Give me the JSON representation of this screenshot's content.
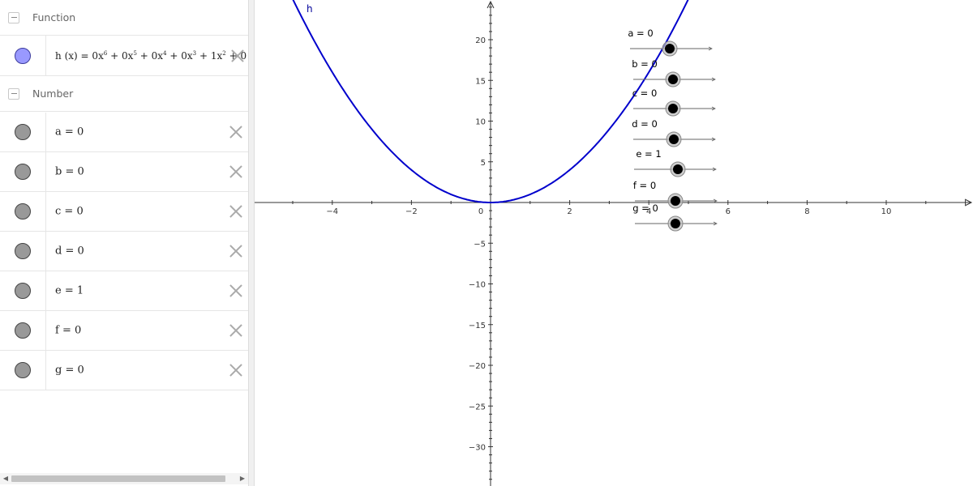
{
  "algebra": {
    "function_group": {
      "label": "Function"
    },
    "function": {
      "name": "h",
      "arg": "(x)",
      "equals": "=",
      "terms": [
        {
          "coef": "0",
          "var": "x",
          "exp": "6"
        },
        {
          "coef": "0",
          "var": "x",
          "exp": "5"
        },
        {
          "coef": "0",
          "var": "x",
          "exp": "4"
        },
        {
          "coef": "0",
          "var": "x",
          "exp": "3"
        },
        {
          "coef": "1",
          "var": "x",
          "exp": "2"
        }
      ],
      "plus": "+",
      "trailing": "0"
    },
    "number_group": {
      "label": "Number"
    },
    "numbers": [
      {
        "name": "a",
        "value": "0"
      },
      {
        "name": "b",
        "value": "0"
      },
      {
        "name": "c",
        "value": "0"
      },
      {
        "name": "d",
        "value": "0"
      },
      {
        "name": "e",
        "value": "1"
      },
      {
        "name": "f",
        "value": "0"
      },
      {
        "name": "g",
        "value": "0"
      }
    ]
  },
  "graphics": {
    "function_label": "h",
    "x_ticks": [
      "−4",
      "−2",
      "0",
      "2",
      "4",
      "6",
      "8",
      "10"
    ],
    "y_ticks": [
      "20",
      "15",
      "10",
      "5",
      "−5",
      "−10",
      "−15",
      "−20",
      "−25",
      "−30"
    ],
    "sliders": [
      {
        "label": "a = 0",
        "value": 0
      },
      {
        "label": "b = 0",
        "value": 0
      },
      {
        "label": "c = 0",
        "value": 0
      },
      {
        "label": "d = 0",
        "value": 0
      },
      {
        "label": "e = 1",
        "value": 1
      },
      {
        "label": "f = 0",
        "value": 0
      },
      {
        "label": "g = 0",
        "value": 0
      }
    ]
  },
  "colors": {
    "curve": "#0000cc",
    "axis": "#333333",
    "function_marble": "#9999ff",
    "number_marble": "#999999"
  }
}
